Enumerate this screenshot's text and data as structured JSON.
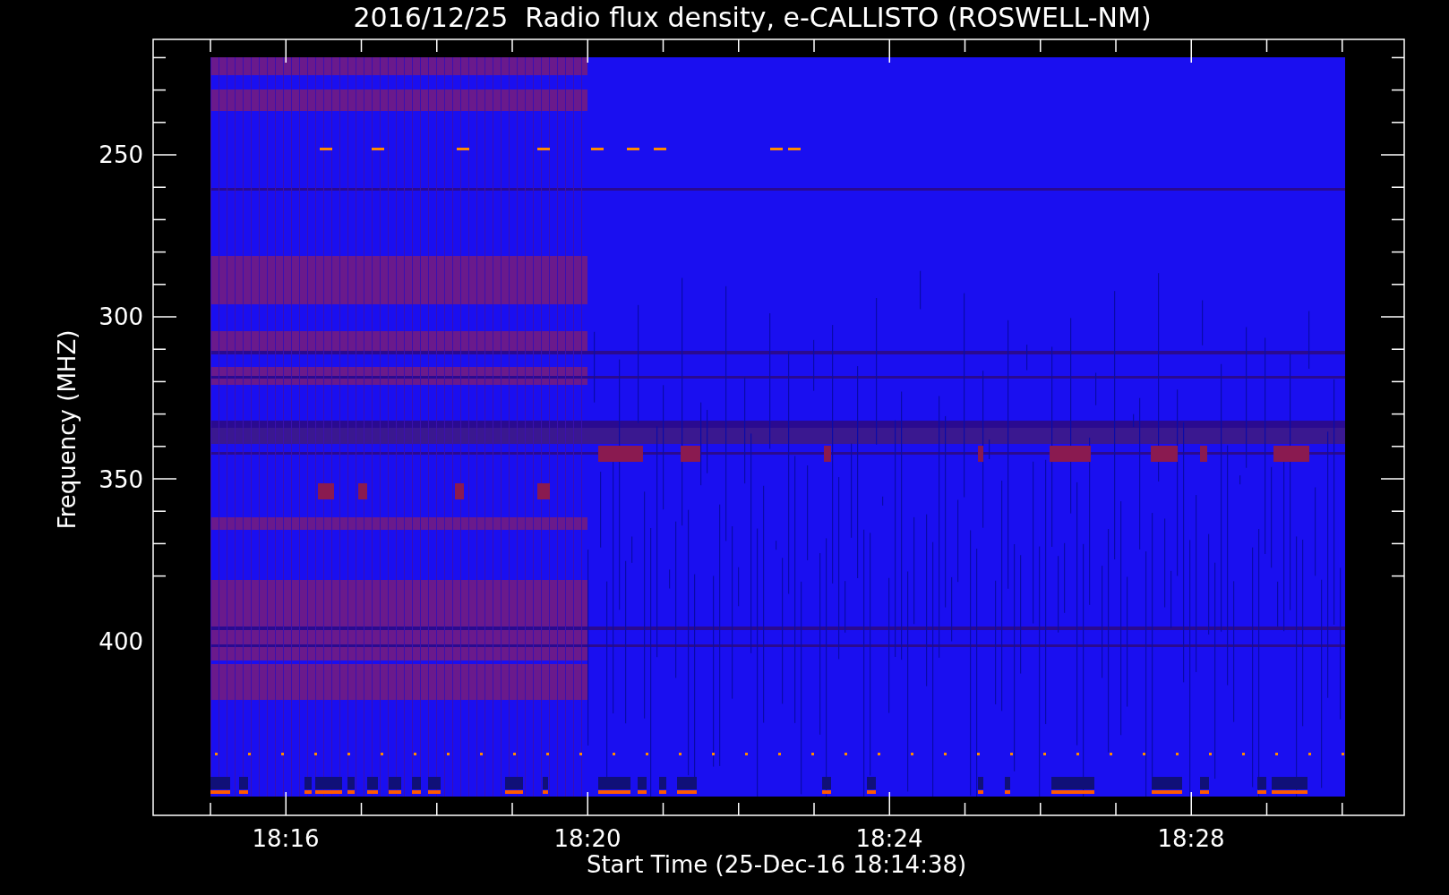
{
  "title": "2016/12/25  Radio flux density, e-CALLISTO (ROSWELL-NM)",
  "y_axis": {
    "label": "Frequency (MHZ)",
    "ticks": [
      "250",
      "300",
      "350",
      "400"
    ]
  },
  "x_axis": {
    "label": "Start Time (25-Dec-16 18:14:38)",
    "ticks": [
      "18:16",
      "18:20",
      "18:24",
      "18:28"
    ]
  }
}
